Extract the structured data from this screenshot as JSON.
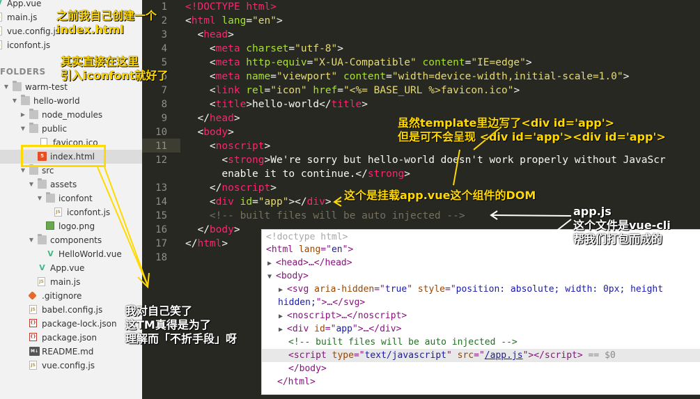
{
  "sidebar": {
    "top_files": [
      {
        "label": "App.vue",
        "icon": "vue-file-icon"
      },
      {
        "label": "main.js",
        "icon": "js-file-icon"
      },
      {
        "label": "vue.config.js",
        "icon": "js-file-icon"
      },
      {
        "label": "iconfont.js",
        "icon": "js-file-icon"
      }
    ],
    "folders_header": "FOLDERS",
    "tree": [
      {
        "label": "warm-test",
        "icon": "folder-icon",
        "expanded": true
      },
      {
        "label": "hello-world",
        "icon": "folder-icon",
        "expanded": true
      },
      {
        "label": "node_modules",
        "icon": "folder-icon",
        "expanded": false
      },
      {
        "label": "public",
        "icon": "folder-icon",
        "expanded": true
      },
      {
        "label": "favicon.ico",
        "icon": "file-icon"
      },
      {
        "label": "index.html",
        "icon": "html5-file-icon",
        "selected": true
      },
      {
        "label": "src",
        "icon": "folder-icon",
        "expanded": true
      },
      {
        "label": "assets",
        "icon": "folder-icon",
        "expanded": true
      },
      {
        "label": "iconfont",
        "icon": "folder-icon",
        "expanded": true
      },
      {
        "label": "iconfont.js",
        "icon": "js-file-icon"
      },
      {
        "label": "logo.png",
        "icon": "png-file-icon"
      },
      {
        "label": "components",
        "icon": "folder-icon",
        "expanded": true
      },
      {
        "label": "HelloWorld.vue",
        "icon": "vue-file-icon"
      },
      {
        "label": "App.vue",
        "icon": "vue-file-icon"
      },
      {
        "label": "main.js",
        "icon": "js-file-icon"
      },
      {
        "label": ".gitignore",
        "icon": "git-icon"
      },
      {
        "label": "babel.config.js",
        "icon": "js-file-icon"
      },
      {
        "label": "package-lock.json",
        "icon": "json-file-icon"
      },
      {
        "label": "package.json",
        "icon": "json-file-icon"
      },
      {
        "label": "README.md",
        "icon": "markdown-file-icon"
      },
      {
        "label": "vue.config.js",
        "icon": "js-file-icon"
      }
    ]
  },
  "editor": {
    "line_numbers": [
      "1",
      "2",
      "3",
      "4",
      "5",
      "6",
      "7",
      "8",
      "9",
      "10",
      "11",
      "12",
      "",
      "13",
      "14",
      "15",
      "16",
      "17",
      "18"
    ],
    "current_line": "11",
    "lines": {
      "l1": {
        "a": "<!DOCTYPE ",
        "b": "html",
        "c": ">"
      },
      "l2": {
        "a": "<",
        "b": "html",
        "c": " lang",
        "d": "=",
        "e": "\"en\"",
        "f": ">"
      },
      "l3": {
        "a": "  <",
        "b": "head",
        "c": ">"
      },
      "l4": {
        "a": "    <",
        "b": "meta",
        "c": " charset",
        "d": "=",
        "e": "\"utf-8\"",
        "f": ">"
      },
      "l5": {
        "a": "    <",
        "b": "meta",
        "c": " http-equiv",
        "d": "=",
        "e": "\"X-UA-Compatible\"",
        "f": " content",
        "g": "=",
        "h": "\"IE=edge\"",
        "i": ">"
      },
      "l6": {
        "a": "    <",
        "b": "meta",
        "c": " name",
        "d": "=",
        "e": "\"viewport\"",
        "f": " content",
        "g": "=",
        "h": "\"width=device-width,initial-scale=1.0\"",
        "i": ">"
      },
      "l7": {
        "a": "    <",
        "b": "link",
        "c": " rel",
        "d": "=",
        "e": "\"icon\"",
        "f": " href",
        "g": "=",
        "h": "\"<%= BASE_URL %>favicon.ico\"",
        "i": ">"
      },
      "l8": {
        "a": "    <",
        "b": "title",
        "c": ">hello-world</",
        "d": "title",
        "e": ">"
      },
      "l9": {
        "a": "  </",
        "b": "head",
        "c": ">"
      },
      "l10": {
        "a": "  <",
        "b": "body",
        "c": ">"
      },
      "l11": {
        "a": "    <",
        "b": "noscript",
        "c": ">"
      },
      "l12": {
        "a": "      <",
        "b": "strong",
        "c": ">We're sorry but hello-world doesn't work properly without JavaScr"
      },
      "l12b": {
        "a": "      enable it to continue.</",
        "b": "strong",
        "c": ">"
      },
      "l13": {
        "a": "    </",
        "b": "noscript",
        "c": ">"
      },
      "l14": {
        "a": "    <",
        "b": "div",
        "c": " id",
        "d": "=",
        "e": "\"app\"",
        "f": "></",
        "g": "div",
        "h": ">"
      },
      "l15": {
        "a": "    <!-- built files will be auto injected -->"
      },
      "l16": {
        "a": "  </",
        "b": "body",
        "c": ">"
      },
      "l17": {
        "a": "</",
        "b": "html",
        "c": ">"
      }
    }
  },
  "devtools": {
    "d1": "<!doctype html>",
    "d2": {
      "a": "<",
      "b": "html",
      "c": " lang",
      "d": "=\"",
      "e": "en",
      "f": "\">"
    },
    "d3": {
      "tri": "▶",
      "a": "<",
      "b": "head",
      "c": ">…</",
      "d": "head",
      "e": ">"
    },
    "d4": {
      "tri": "▼",
      "a": "<",
      "b": "body",
      "c": ">"
    },
    "d5": {
      "tri": "▶",
      "a": "<",
      "b": "svg",
      "c": " aria-hidden",
      "d": "=\"",
      "e": "true",
      "f": "\"",
      "g": " style",
      "h": "=\"",
      "i": "position: absolute; width: 0px; height"
    },
    "d5b": {
      "a": "hidden;",
      "b": "\">…</",
      "c": "svg",
      "d": ">"
    },
    "d6": {
      "tri": "▶",
      "a": "<",
      "b": "noscript",
      "c": ">…</",
      "d": "noscript",
      "e": ">"
    },
    "d7": {
      "tri": "▶",
      "a": "<",
      "b": "div",
      "c": " id",
      "d": "=\"",
      "e": "app",
      "f": "\">…</",
      "g": "div",
      "h": ">"
    },
    "d8": "<!-- built files will be auto injected -->",
    "d9": {
      "a": "<",
      "b": "script",
      "c": " type",
      "d": "=\"",
      "e": "text/javascript",
      "f": "\"",
      "g": " src",
      "h": "=\"",
      "i": "/app.js",
      "j": "\"></",
      "k": "script",
      "l": ">",
      "m": " == $0"
    },
    "d10": {
      "a": "</",
      "b": "body",
      "c": ">"
    },
    "d11": {
      "a": "</",
      "b": "html",
      "c": ">"
    }
  },
  "annotations": {
    "n1": [
      "之前我自己创建一个",
      "index.html"
    ],
    "n2": [
      "其实直接在这里",
      "引入iconfont就好了"
    ],
    "n3": [
      "虽然template里边写了<div id='app'>",
      "但是可不会呈现 <div id='app'><div id='app'>"
    ],
    "n4": "这个是挂载app.vue这个组件的DOM",
    "n5": [
      "app.js",
      "这个文件是vue-cli",
      "帮我们打包而成的"
    ],
    "n6": [
      "我对自己笑了",
      "这TM真得是为了",
      "理解而「不折手段」呀"
    ]
  },
  "colors": {
    "annotation": "#ffd900",
    "editor_bg": "#272822",
    "tag": "#f92672",
    "attr": "#a6e22e",
    "string": "#e6db74",
    "comment": "#75715e"
  }
}
